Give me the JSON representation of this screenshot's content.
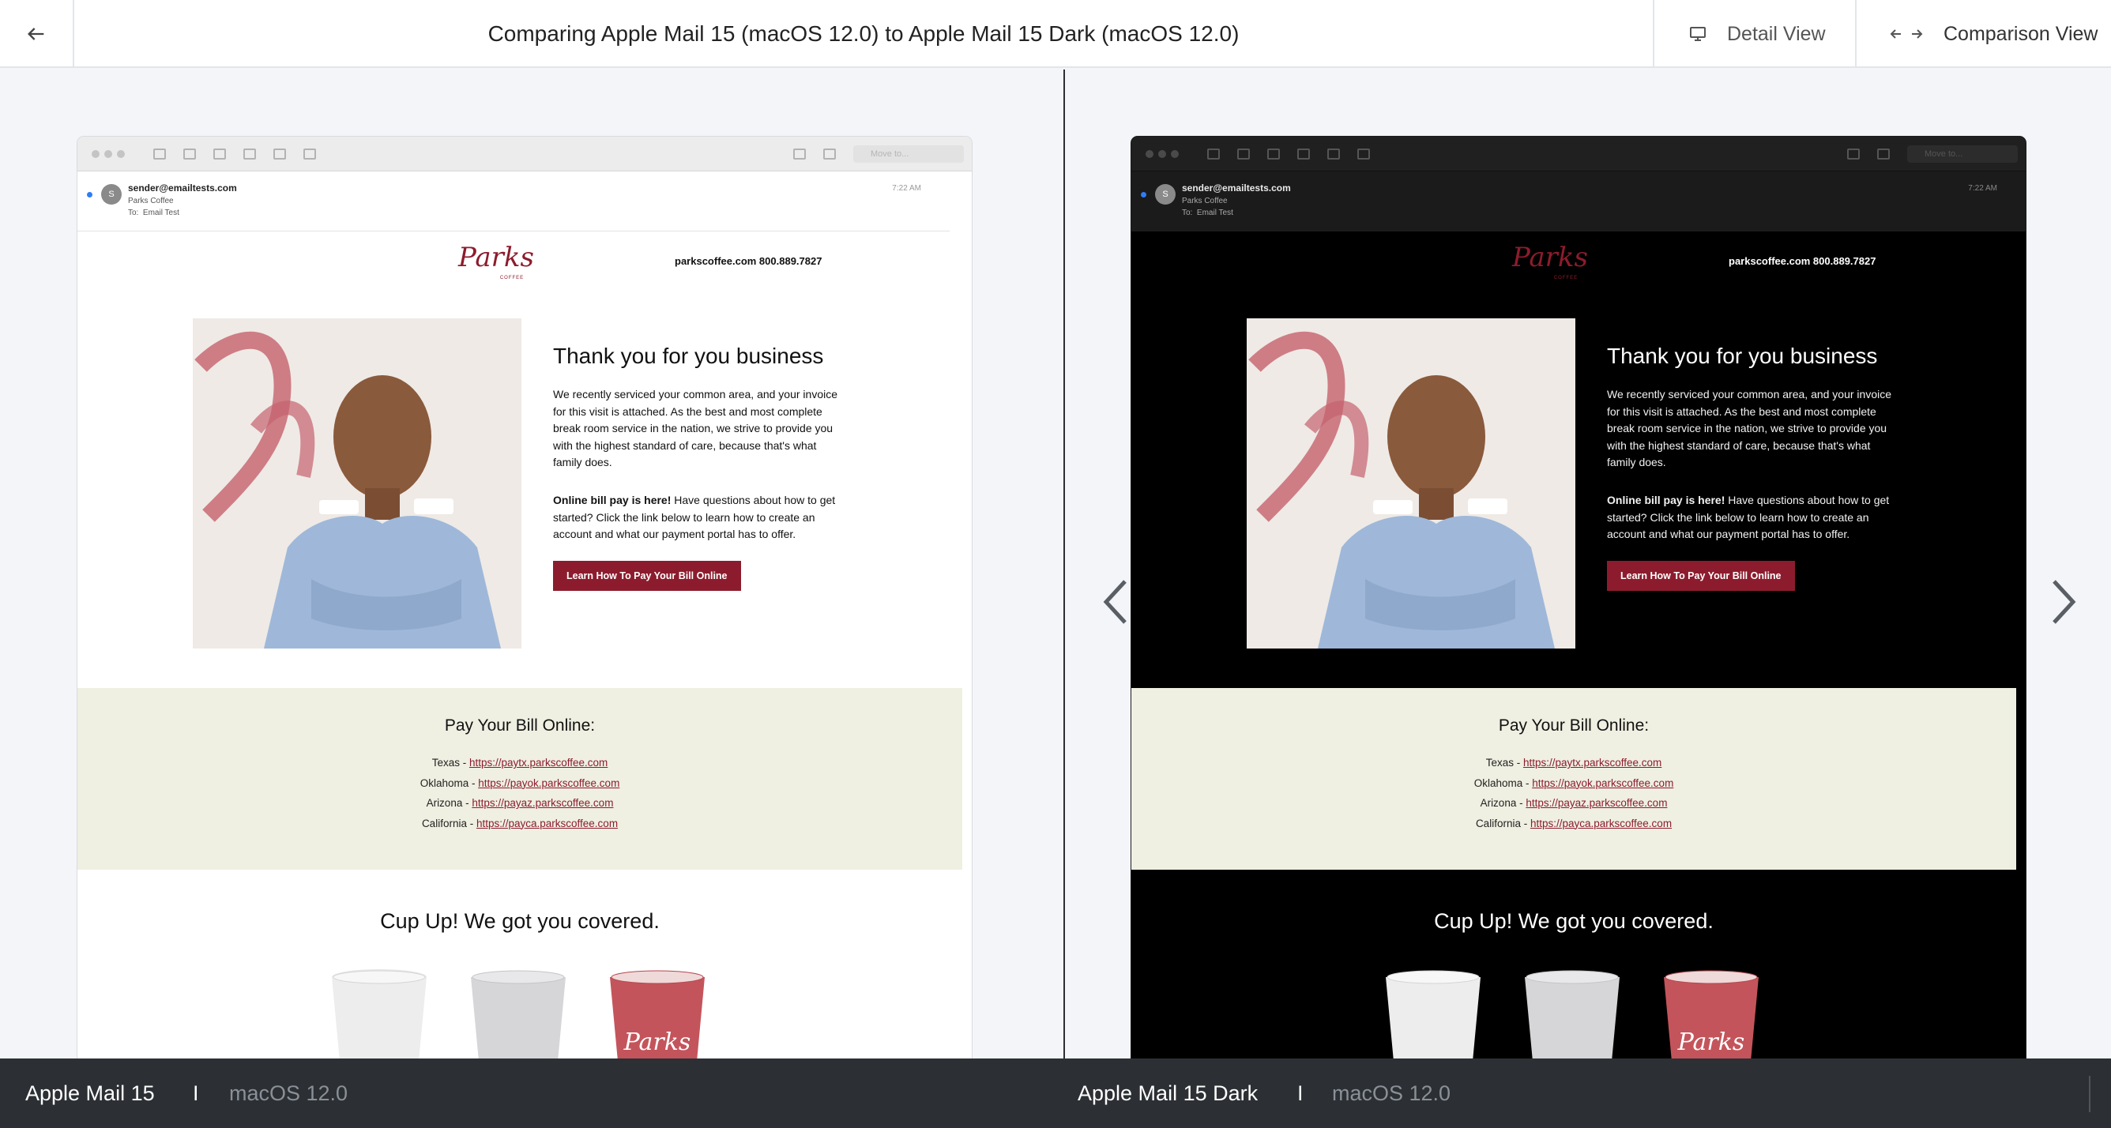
{
  "header": {
    "title": "Comparing Apple Mail 15 (macOS 12.0) to Apple Mail 15 Dark (macOS 12.0)",
    "detail_view_label": "Detail View",
    "comparison_view_label": "Comparison View"
  },
  "mail": {
    "sender_email": "sender@emailtests.com",
    "sender_name": "Parks Coffee",
    "to_label": "To:",
    "to_value": "Email Test",
    "time": "7:22 AM",
    "avatar_initial": "S",
    "move_to_placeholder": "Move to..."
  },
  "email": {
    "contact": "parkscoffee.com  800.889.7827",
    "hero_title": "Thank you for you business",
    "hero_paragraph": "We recently serviced your common area, and your invoice for this visit is attached. As the best and most complete break room service in the nation, we strive to provide you with the highest standard of care, because that's what family does.",
    "bill_pay_bold": "Online bill pay is here!",
    "bill_pay_text": " Have questions about how to get started? Click the link below to learn how to create an account and what our payment portal has to offer.",
    "cta_label": "Learn How To Pay Your Bill Online",
    "pay_title": "Pay Your Bill Online:",
    "pay_links": [
      {
        "state": "Texas - ",
        "url": "https://paytx.parkscoffee.com"
      },
      {
        "state": "Oklahoma - ",
        "url": "https://payok.parkscoffee.com"
      },
      {
        "state": "Arizona - ",
        "url": "https://payaz.parkscoffee.com"
      },
      {
        "state": "California - ",
        "url": "https://payca.parkscoffee.com"
      }
    ],
    "cup_title": "Cup Up! We got you covered."
  },
  "footer": {
    "left_client": "Apple Mail 15",
    "left_os": "macOS 12.0",
    "right_client": "Apple Mail 15 Dark",
    "right_os": "macOS 12.0",
    "separator": "I"
  },
  "colors": {
    "brand_red": "#8c1c2d",
    "pay_bg": "#efefe2",
    "footer_bg": "#2c3034"
  }
}
